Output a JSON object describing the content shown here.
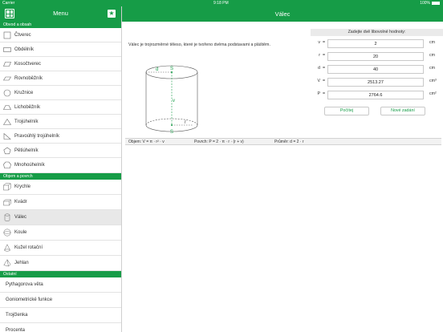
{
  "status_bar": {
    "carrier": "Carrier",
    "time": "9:18 PM",
    "battery": "100%"
  },
  "sidebar": {
    "title": "Menu",
    "sections": [
      {
        "label": "Obvod a obsah",
        "items": [
          {
            "label": "Čtverec",
            "icon": "square-icon"
          },
          {
            "label": "Obdélník",
            "icon": "rectangle-icon"
          },
          {
            "label": "Kosočtverec",
            "icon": "rhombus-icon"
          },
          {
            "label": "Rovnoběžník",
            "icon": "parallelogram-icon"
          },
          {
            "label": "Kružnice",
            "icon": "circle-icon"
          },
          {
            "label": "Lichoběžník",
            "icon": "trapezoid-icon"
          },
          {
            "label": "Trojúhelník",
            "icon": "triangle-icon"
          },
          {
            "label": "Pravoúhlý trojúhelník",
            "icon": "right-triangle-icon"
          },
          {
            "label": "Pětiúhelník",
            "icon": "pentagon-icon"
          },
          {
            "label": "Mnohoúhelník",
            "icon": "polygon-icon"
          }
        ]
      },
      {
        "label": "Objem a povrch",
        "items": [
          {
            "label": "Krychle",
            "icon": "cube-icon"
          },
          {
            "label": "Kvádr",
            "icon": "cuboid-icon"
          },
          {
            "label": "Válec",
            "icon": "cylinder-icon"
          },
          {
            "label": "Koule",
            "icon": "sphere-icon"
          },
          {
            "label": "Kužel rotační",
            "icon": "cone-icon"
          },
          {
            "label": "Jehlan",
            "icon": "pyramid-icon"
          }
        ]
      },
      {
        "label": "Ostatní",
        "items": [
          {
            "label": "Pythagorova věta"
          },
          {
            "label": "Goniometrické funkce"
          },
          {
            "label": "Trojčlenka"
          },
          {
            "label": "Procenta"
          }
        ]
      }
    ]
  },
  "main": {
    "title": "Válec",
    "description": "Válec je trojrozměrné těleso, které je tvořeno dvěma podstavami a pláštěm.",
    "panel_title": "Zadejte dvě libovolné hodnoty:",
    "fields": [
      {
        "var": "v",
        "value": "2",
        "unit": "cm"
      },
      {
        "var": "r",
        "value": "20",
        "unit": "cm"
      },
      {
        "var": "d",
        "value": "40",
        "unit": "cm"
      },
      {
        "var": "V",
        "value": "2513.27",
        "unit": "cm³"
      },
      {
        "var": "P",
        "value": "2764.6",
        "unit": "cm²"
      }
    ],
    "buttons": {
      "calculate": "Počítej",
      "reset": "Nové zadání"
    },
    "diagram": {
      "d": "d",
      "v": "v",
      "r": "r",
      "s_top": "S",
      "s_bottom": "S"
    },
    "formulas": {
      "volume": "Objem: V = π · r² · v",
      "surface": "Povrch: P = 2 · π · r · (r + v)",
      "diameter": "Průměr: d = 2 · r"
    },
    "accent_color": "#169c47"
  }
}
